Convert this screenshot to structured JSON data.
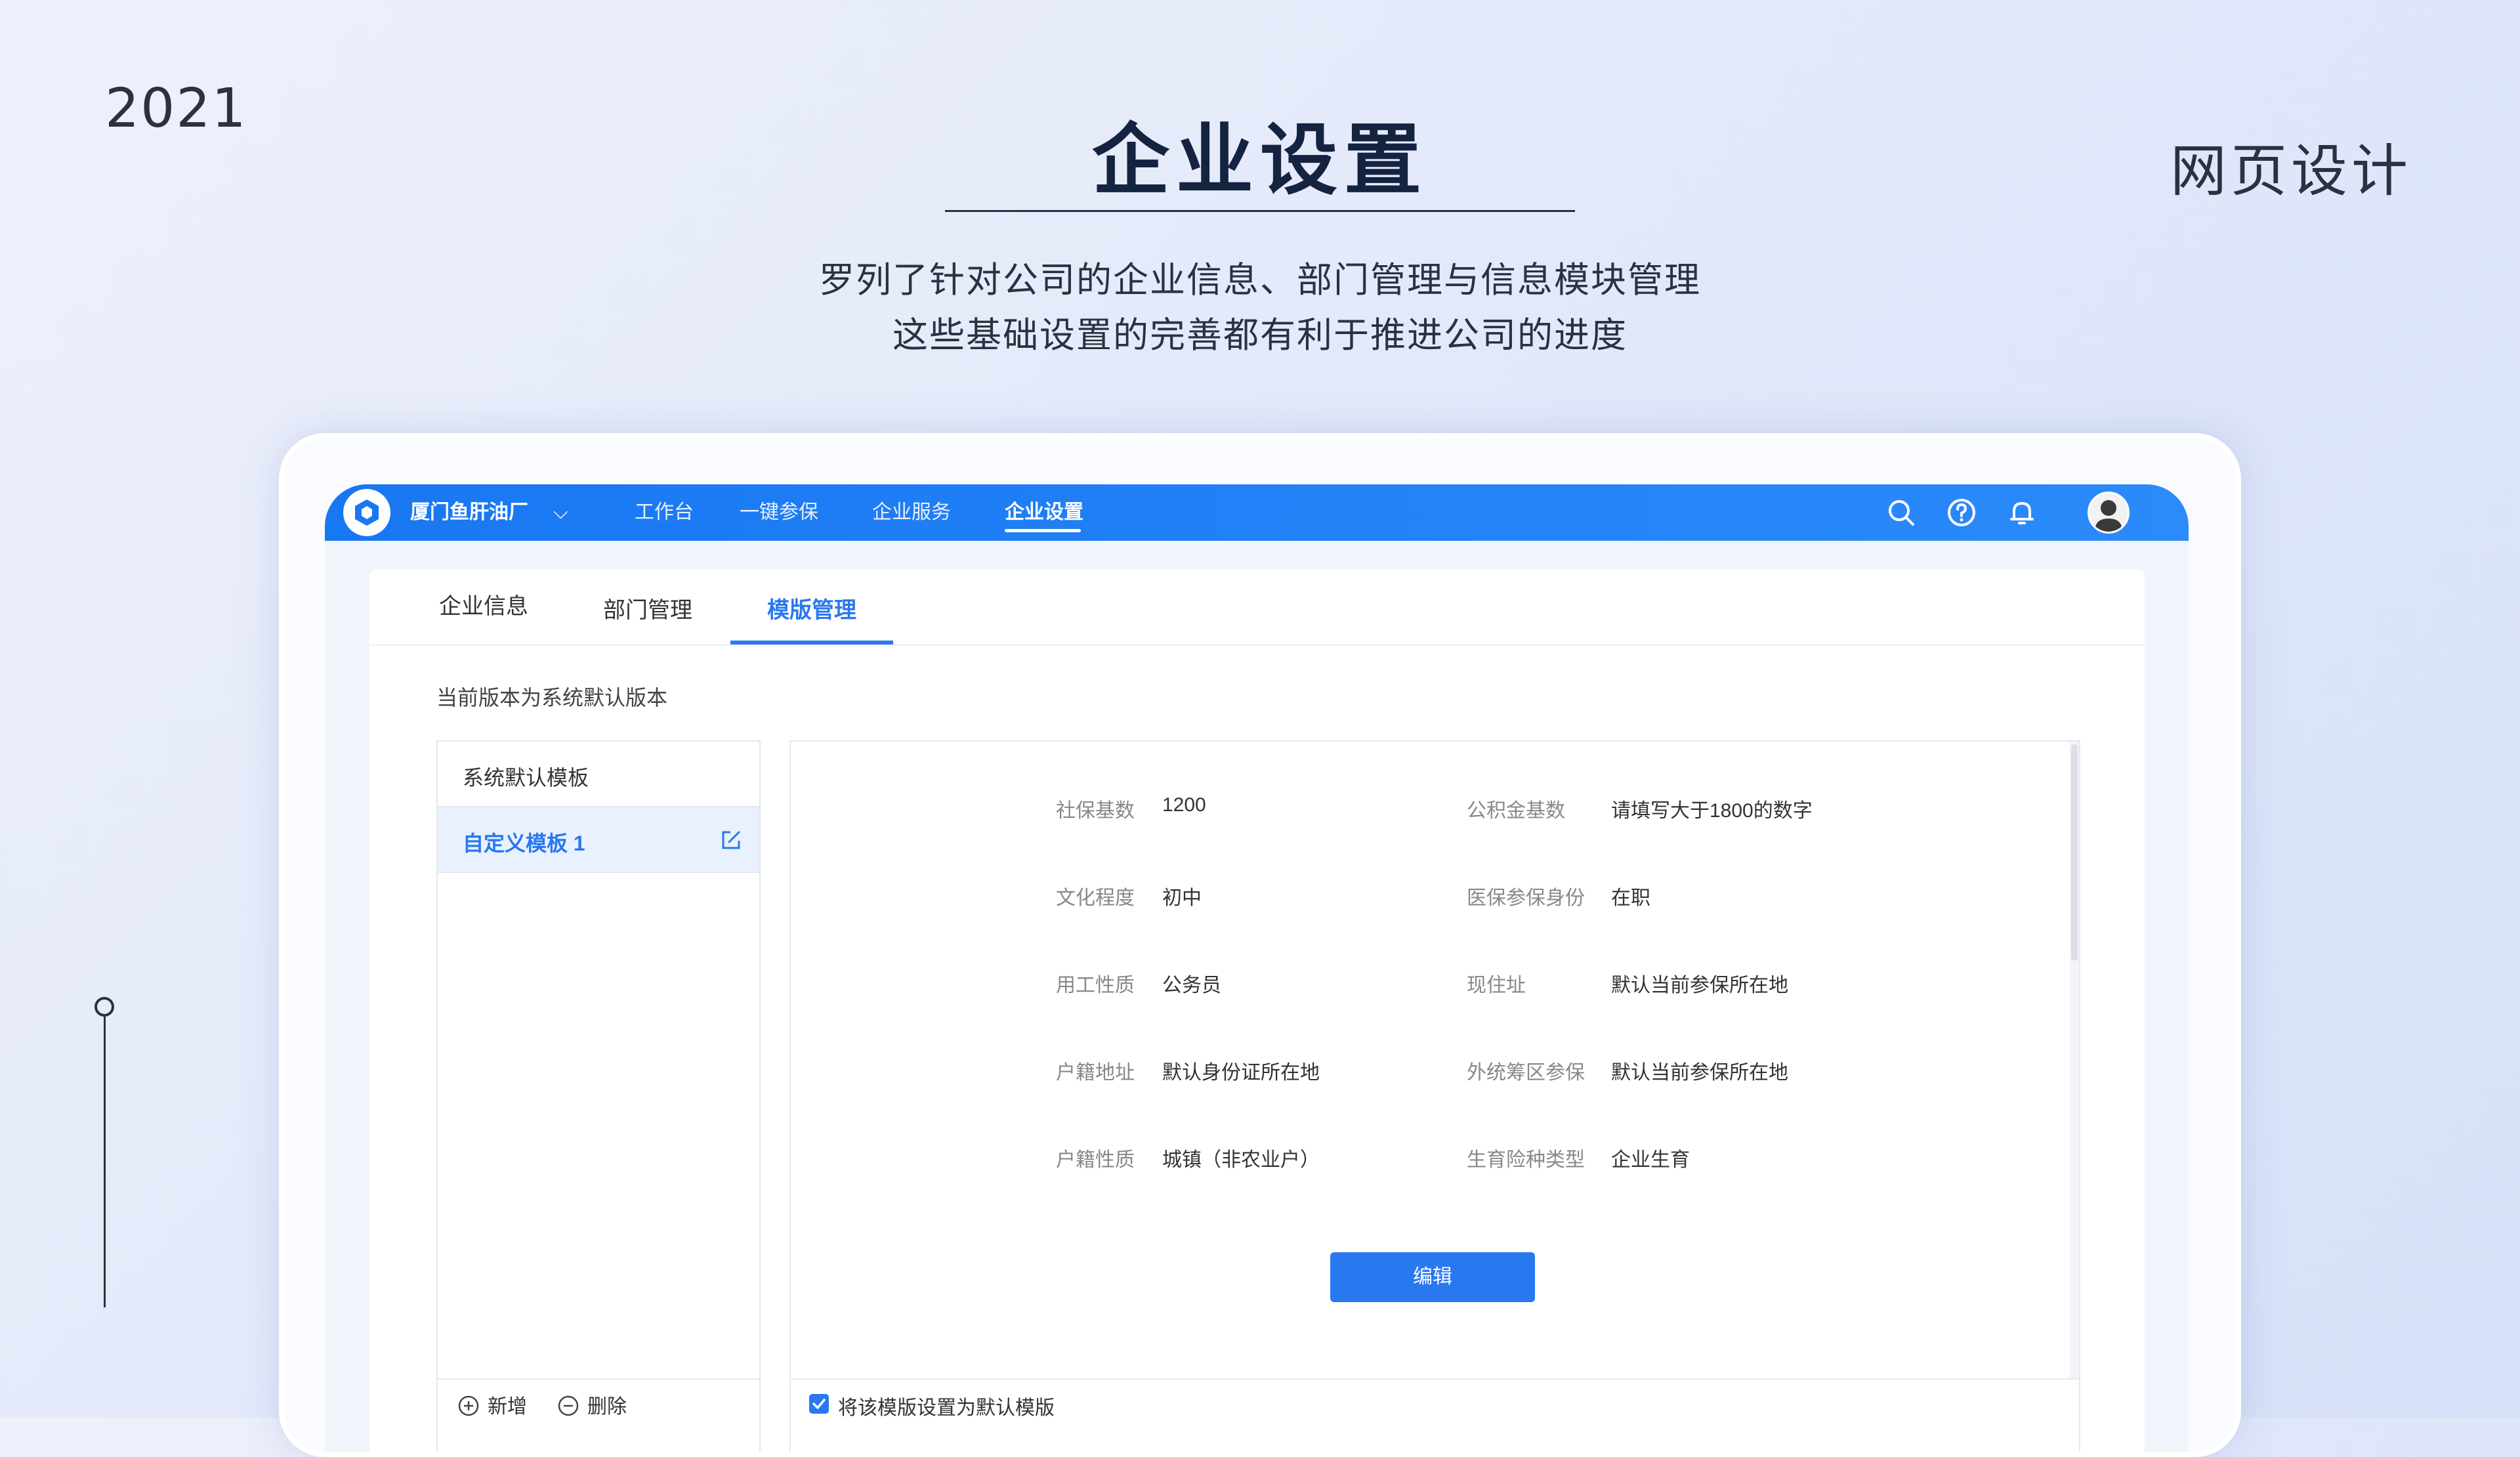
{
  "slide": {
    "year": "2021",
    "corner_label": "网页设计",
    "title": "企业设置",
    "subtitle_line1": "罗列了针对公司的企业信息、部门管理与信息模块管理",
    "subtitle_line2": "这些基础设置的完善都有利于推进公司的进度"
  },
  "topbar": {
    "company": "厦门鱼肝油厂",
    "nav": [
      {
        "label": "工作台",
        "active": false
      },
      {
        "label": "一键参保",
        "active": false
      },
      {
        "label": "企业服务",
        "active": false
      },
      {
        "label": "企业设置",
        "active": true
      }
    ],
    "icons": [
      "search-icon",
      "help-icon",
      "bell-icon",
      "user-avatar"
    ],
    "accent": "#1877f2"
  },
  "tabs": [
    {
      "label": "企业信息",
      "active": false
    },
    {
      "label": "部门管理",
      "active": false
    },
    {
      "label": "模版管理",
      "active": true
    }
  ],
  "version_note": "当前版本为系统默认版本",
  "templates": [
    {
      "label": "系统默认模板",
      "selected": false
    },
    {
      "label": "自定义模板 1",
      "selected": true
    }
  ],
  "list_footer": {
    "add": "新增",
    "remove": "删除"
  },
  "fields": [
    {
      "label": "社保基数",
      "value": "1200"
    },
    {
      "label": "公积金基数",
      "value": "请填写大于1800的数字"
    },
    {
      "label": "文化程度",
      "value": "初中"
    },
    {
      "label": "医保参保身份",
      "value": "在职"
    },
    {
      "label": "用工性质",
      "value": "公务员"
    },
    {
      "label": "现住址",
      "value": "默认当前参保所在地"
    },
    {
      "label": "户籍地址",
      "value": "默认身份证所在地"
    },
    {
      "label": "外统筹区参保",
      "value": "默认当前参保所在地"
    },
    {
      "label": "户籍性质",
      "value": "城镇（非农业户）"
    },
    {
      "label": "生育险种类型",
      "value": "企业生育"
    }
  ],
  "edit_button": "编辑",
  "default_checkbox": {
    "label": "将该模版设置为默认模版",
    "checked": true
  }
}
